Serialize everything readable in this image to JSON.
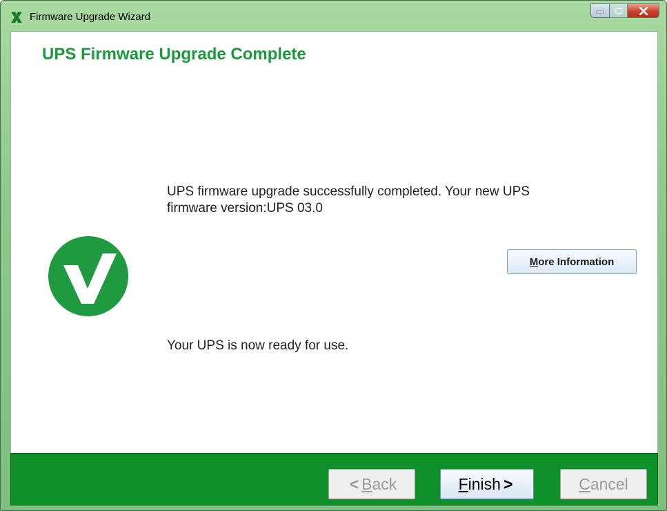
{
  "window": {
    "title": "Firmware Upgrade Wizard",
    "controls": {
      "minimize": "minimize-icon",
      "maximize": "maximize-icon",
      "close": "close-icon"
    }
  },
  "main": {
    "heading": "UPS Firmware Upgrade Complete",
    "message_line1": "UPS firmware upgrade successfully completed. Your new UPS",
    "message_line2": "firmware version:UPS 03.0",
    "ready_message": "Your UPS is now ready for use.",
    "more_info": {
      "mnemonic": "M",
      "rest": "ore Information"
    },
    "status_icon": "check-circle-icon"
  },
  "footer": {
    "back": {
      "arrow": "<",
      "mnemonic": "B",
      "rest": "ack"
    },
    "finish": {
      "mnemonic": "F",
      "rest": "inish",
      "arrow": ">"
    },
    "cancel": {
      "mnemonic": "C",
      "rest": "ancel"
    }
  },
  "colors": {
    "accent_green": "#1b9a3a",
    "footer_green": "#10902a",
    "titlebar_green": "#8cc98a"
  }
}
